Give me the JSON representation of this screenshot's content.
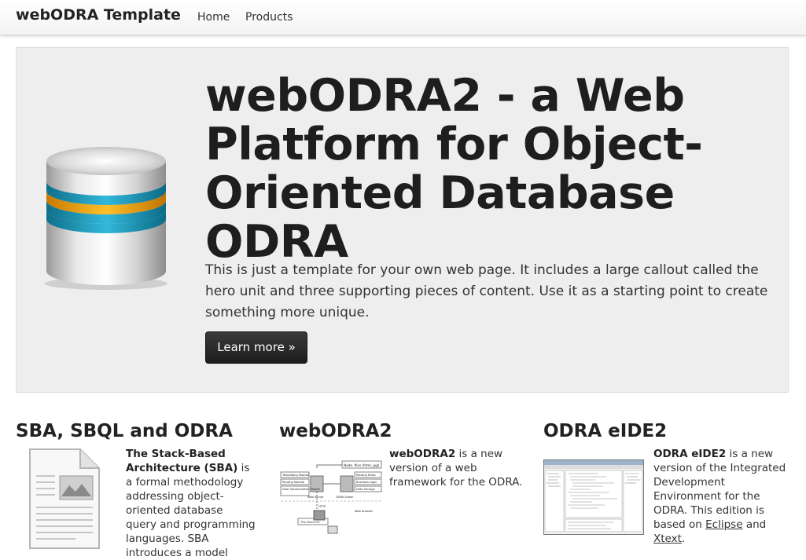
{
  "navbar": {
    "brand": "webODRA Template",
    "items": [
      {
        "label": "Home"
      },
      {
        "label": "Products"
      }
    ]
  },
  "hero": {
    "title": "webODRA2 - a Web Platform for Object-Oriented Database ODRA",
    "text": "This is just a template for your own web page. It includes a large callout called the hero unit and three supporting pieces of content. Use it as a starting point to create something more unique.",
    "button_label": "Learn more »"
  },
  "columns": [
    {
      "title": "SBA, SBQL and ODRA",
      "bold": "The Stack-Based Architecture (SBA)",
      "text": " is a formal methodology addressing object-oriented database query and programming languages. SBA",
      "cut_line": "introduces a model"
    },
    {
      "title": "webODRA2",
      "bold": "webODRA2",
      "text": " is a new version of a web framework for the ODRA.",
      "diagram_labels": [
        "Node. files (html, jpg)",
        "Templating Module",
        "Routing Module",
        "Data Transformation Module",
        "Routing Rules",
        "Business Logic",
        "Data Storage",
        "Web Server",
        "ODRA Odam",
        "The Client OS",
        "Web browser",
        "HTTP"
      ]
    },
    {
      "title": "ODRA eIDE2",
      "bold": "ODRA eIDE2",
      "text": " is a new version of the Integrated Development Environment for the ODRA. This edition is based on ",
      "link1": "Eclipse",
      "mid": " and ",
      "link2": "Xtext",
      "end": "."
    }
  ],
  "colors": {
    "hero_bg": "#eeeeee",
    "button_bg": "#222222",
    "text": "#222222"
  }
}
